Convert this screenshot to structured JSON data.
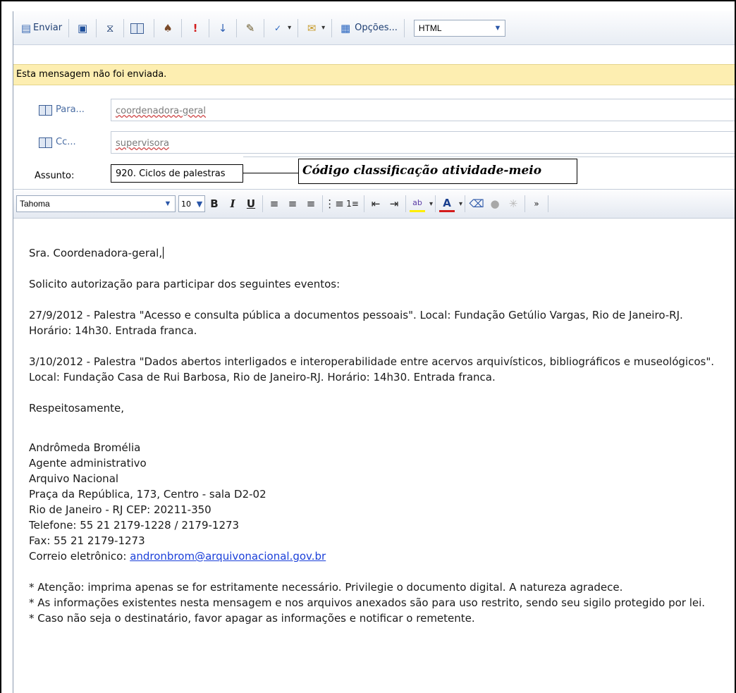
{
  "toolbar": {
    "send_label": "Enviar",
    "options_label": "Opções...",
    "format_value": "HTML"
  },
  "infobar": {
    "text": "Esta mensagem não foi enviada."
  },
  "to": {
    "button_label": "Para...",
    "value": "coordenadora-geral"
  },
  "cc": {
    "button_label": "Cc...",
    "value": "supervisora"
  },
  "subject": {
    "label": "Assunto:",
    "value": "920. Ciclos de palestras"
  },
  "callout": {
    "text": "Código classificação atividade-meio"
  },
  "format_bar": {
    "font": "Tahoma",
    "size": "10"
  },
  "body": {
    "greeting": "Sra. Coordenadora-geral,",
    "request": "Solicito autorização para participar dos seguintes eventos:",
    "event1": "27/9/2012 - Palestra \"Acesso e consulta pública a documentos pessoais\". Local: Fundação Getúlio Vargas, Rio de Janeiro-RJ. Horário: 14h30. Entrada franca.",
    "event2": "3/10/2012 - Palestra \"Dados abertos interligados e interoperabilidade entre acervos arquivísticos, bibliográficos e museológicos\". Local: Fundação Casa de Rui Barbosa, Rio de Janeiro-RJ. Horário: 14h30. Entrada franca.",
    "closing": "Respeitosamente,",
    "signature": [
      "Andrômeda Bromélia",
      "Agente administrativo",
      "Arquivo Nacional",
      "Praça da República, 173, Centro - sala D2-02",
      "Rio de Janeiro - RJ CEP: 20211-350",
      "Telefone: 55 21 2179-1228 / 2179-1273",
      "Fax: 55 21 2179-1273"
    ],
    "email_label": "Correio eletrônico: ",
    "email": "andronbrom@arquivonacional.gov.br",
    "notes": [
      "* Atenção: imprima apenas se for estritamente necessário. Privilegie o documento digital. A natureza agradece.",
      "* As informações existentes nesta mensagem e nos arquivos anexados são para uso restrito, sendo seu sigilo protegido por lei.",
      "* Caso não seja o destinatário, favor apagar as informações e notificar o remetente."
    ]
  }
}
